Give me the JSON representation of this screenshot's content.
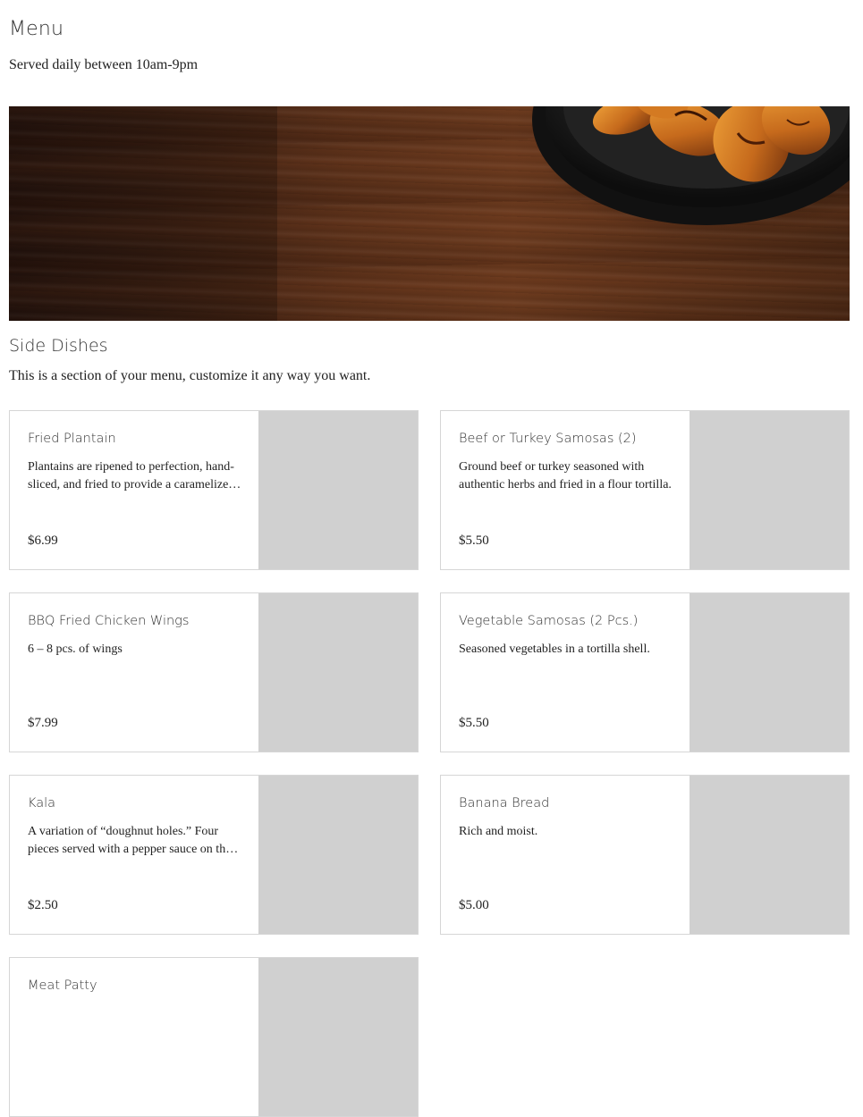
{
  "menu": {
    "title": "Menu",
    "subtitle": "Served daily between 10am-9pm"
  },
  "hero": {
    "image": "fried-plantains-on-wooden-table"
  },
  "section": {
    "title": "Side Dishes",
    "description": "This is a section of your menu, customize it any way you want."
  },
  "items": [
    {
      "name": "Fried Plantain",
      "description": "Plantains are ripened to perfection, hand-sliced, and fried to provide a caramelized flavor.",
      "price": "$6.99"
    },
    {
      "name": "Beef or Turkey Samosas (2)",
      "description": "Ground beef or turkey seasoned with authentic herbs and fried in a flour tortilla.",
      "price": "$5.50"
    },
    {
      "name": "BBQ Fried Chicken Wings",
      "description": "6 – 8 pcs. of wings",
      "price": "$7.99"
    },
    {
      "name": "Vegetable Samosas (2 Pcs.)",
      "description": "Seasoned vegetables in a tortilla shell.",
      "price": "$5.50"
    },
    {
      "name": "Kala",
      "description": "A variation of “doughnut holes.” Four pieces served with a pepper sauce on the side.",
      "price": "$2.50"
    },
    {
      "name": "Banana Bread",
      "description": "Rich and moist.",
      "price": "$5.00"
    },
    {
      "name": "Meat Patty",
      "description": "",
      "price": ""
    }
  ],
  "colors": {
    "card_border": "#d6d6d6",
    "image_placeholder": "#d0d0d0",
    "text": "#222222"
  }
}
